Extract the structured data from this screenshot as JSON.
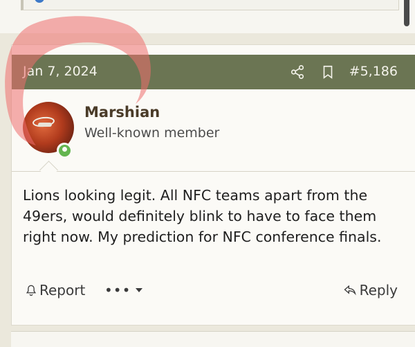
{
  "post": {
    "date": "Jan 7, 2024",
    "number": "#5,186",
    "author": "Marshian",
    "author_title": "Well-known member",
    "body": "Lions looking legit. All NFC teams apart from the 49ers, would definitely blink to have to face them right now. My prediction for NFC conference finals.",
    "actions": {
      "report_label": "Report",
      "more_label": "•••",
      "reply_label": "Reply"
    }
  },
  "icons": {
    "share": "share-icon",
    "bookmark": "bookmark-icon",
    "report": "bell-icon",
    "more": "chevron-down-icon",
    "reply": "reply-arrow-icon",
    "online": "online-status-icon"
  },
  "colors": {
    "header_bg": "#6b7553",
    "header_text": "#f3f2ea",
    "username": "#4a3b28",
    "online": "#63b54f",
    "annotation": "#ef6e6e"
  }
}
